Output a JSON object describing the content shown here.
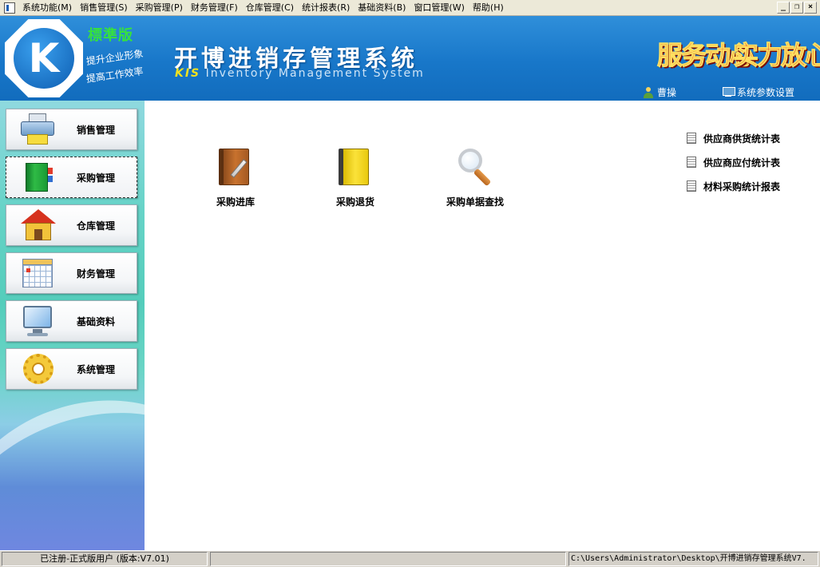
{
  "menubar": {
    "items": [
      "系统功能(M)",
      "销售管理(S)",
      "采购管理(P)",
      "财务管理(F)",
      "仓库管理(C)",
      "统计报表(R)",
      "基础资料(B)",
      "窗口管理(W)",
      "帮助(H)"
    ],
    "window_buttons": [
      "_",
      "❐",
      "×"
    ]
  },
  "banner": {
    "logo_letter": "K",
    "edition": "標準版",
    "slogan_1": "提升企业形象",
    "slogan_2": "提高工作效率",
    "title_cn": "开博进销存管理系统",
    "title_en_prefix": "KIS",
    "title_en": " Inventory Management System",
    "motto_1": "服务动心",
    "motto_2": "实力放心",
    "user_name": "曹操",
    "settings_label": "系统参数设置"
  },
  "sidebar": {
    "items": [
      {
        "label": "销售管理",
        "icon": "printer-icon"
      },
      {
        "label": "采购管理",
        "icon": "green-book-icon",
        "active": true
      },
      {
        "label": "仓库管理",
        "icon": "house-icon"
      },
      {
        "label": "财务管理",
        "icon": "calendar-icon"
      },
      {
        "label": "基础资料",
        "icon": "monitor-icon"
      },
      {
        "label": "系统管理",
        "icon": "gear-icon"
      }
    ]
  },
  "main": {
    "functions": [
      {
        "label": "采购进库",
        "icon": "book-pencil-icon"
      },
      {
        "label": "采购退货",
        "icon": "yellow-book-icon"
      },
      {
        "label": "采购单据查找",
        "icon": "magnifier-icon"
      }
    ],
    "reports": [
      "供应商供货统计表",
      "供应商应付统计表",
      "材料采购统计报表"
    ]
  },
  "statusbar": {
    "registration": "已注册-正式版用户 (版本:V7.01)",
    "path": "C:\\Users\\Administrator\\Desktop\\开博进销存管理系统V7."
  }
}
